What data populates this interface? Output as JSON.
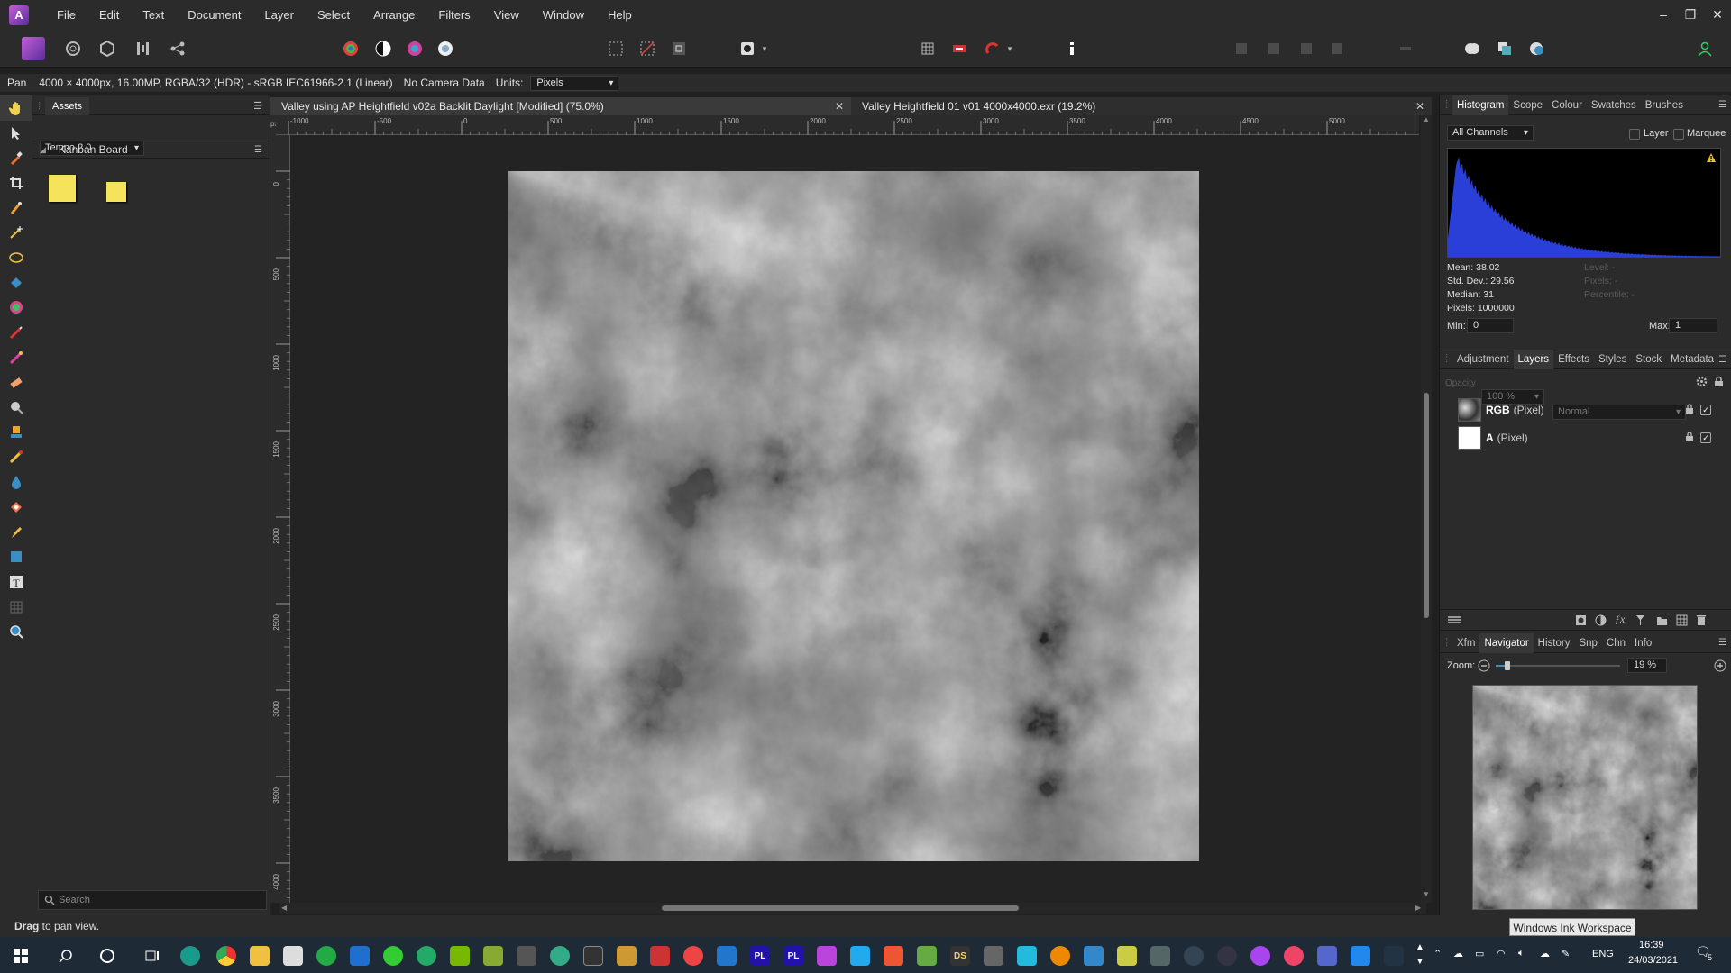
{
  "menu": {
    "items": [
      "File",
      "Edit",
      "Text",
      "Document",
      "Layer",
      "Select",
      "Arrange",
      "Filters",
      "View",
      "Window",
      "Help"
    ]
  },
  "context": {
    "tool_name": "Pan",
    "doc_info": "4000 × 4000px, 16.00MP, RGBA/32 (HDR) - sRGB IEC61966-2.1 (Linear)",
    "camera": "No Camera Data",
    "units_label": "Units:",
    "units_value": "Pixels"
  },
  "assets": {
    "tab": "Assets",
    "category": "Tempo 2.0",
    "group": "Kanban Board",
    "search_placeholder": "Search"
  },
  "documents": {
    "tabs": [
      {
        "title": "Valley using AP Heightfield v02a Backlit Daylight [Modified] (75.0%)"
      },
      {
        "title": "Valley Heightfield 01 v01 4000x4000.exr (19.2%)"
      }
    ]
  },
  "rulers": {
    "h_ticks": [
      "-1000",
      "-500",
      "0",
      "500",
      "1000",
      "1500",
      "2000",
      "2500",
      "3000",
      "3500",
      "4000",
      "4500",
      "5000"
    ],
    "v_ticks": [
      "0",
      "500",
      "1000",
      "1500",
      "2000",
      "2500",
      "3000",
      "3500",
      "4000"
    ]
  },
  "histogram": {
    "tabs": [
      "Histogram",
      "Scope",
      "Colour",
      "Swatches",
      "Brushes"
    ],
    "channel": "All Channels",
    "layer_label": "Layer",
    "marquee_label": "Marquee",
    "mean": "Mean: 38.02",
    "std_dev": "Std. Dev.: 29.56",
    "median": "Median: 31",
    "pixels": "Pixels: 1000000",
    "level": "Level: -",
    "pixels_dim": "Pixels: -",
    "percentile": "Percentile: -",
    "min_label": "Min:",
    "min_value": "0",
    "max_label": "Max:",
    "max_value": "1"
  },
  "layers": {
    "tabs": [
      "Adjustment",
      "Layers",
      "Effects",
      "Styles",
      "Stock",
      "Metadata"
    ],
    "opacity_label": "Opacity",
    "opacity": "100 %",
    "blend": "Normal",
    "rows": [
      {
        "name": "RGB",
        "type": "(Pixel)"
      },
      {
        "name": "A",
        "type": "(Pixel)"
      }
    ]
  },
  "navigator": {
    "tabs": [
      "Xfm",
      "Navigator",
      "History",
      "Snp",
      "Chn",
      "Info"
    ],
    "zoom_label": "Zoom:",
    "zoom_value": "19 %"
  },
  "status": {
    "bold": "Drag",
    "text": " to pan view.",
    "ink_tooltip": "Windows Ink Workspace"
  },
  "taskbar": {
    "lang": "ENG",
    "time": "16:39",
    "date": "24/03/2021",
    "notif_count": "5"
  },
  "colors": {
    "accent": "#7a3fb8",
    "histogram_fill": "#2a3fd8",
    "warning": "#f0c020"
  }
}
